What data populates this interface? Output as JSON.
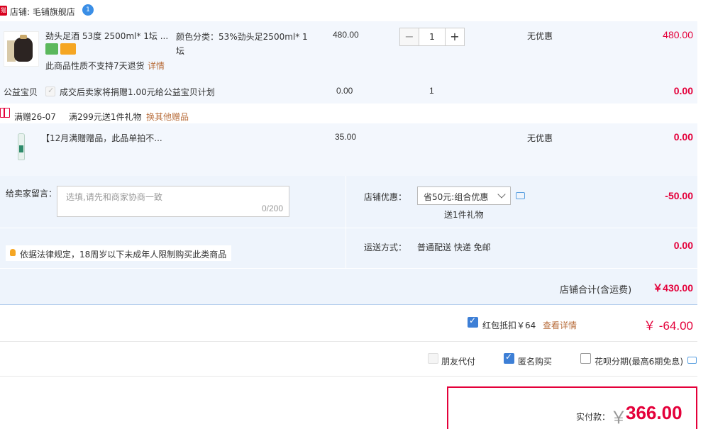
{
  "shop": {
    "badge": "猫",
    "name": "店铺: 毛铺旗舰店",
    "ww": "1"
  },
  "item": {
    "title": "劲头足酒 53度 2500ml* 1坛 ...",
    "sku_label": "颜色分类：53%劲头足2500ml* 1坛",
    "price": "480.00",
    "quantity": "1",
    "discount": "无优惠",
    "subtotal": "480.00",
    "no_return": "此商品性质不支持7天退货",
    "detail_link": "详情"
  },
  "charity": {
    "label": "公益宝贝",
    "text": "成交后卖家将捐赠1.00元给公益宝贝计划",
    "price": "0.00",
    "quantity": "1",
    "subtotal": "0.00"
  },
  "gift_promo": {
    "tag": "满赠26-07",
    "text": "满299元送1件礼物",
    "change_link": "换其他赠品"
  },
  "gift_item": {
    "title": "【12月满赠赠品，此品单拍不...",
    "price": "35.00",
    "discount": "无优惠",
    "subtotal": "0.00"
  },
  "summary": {
    "memo_label": "给卖家留言：",
    "memo_placeholder": "选填,请先和商家协商一致",
    "memo_count": "0/200",
    "shop_discount_label": "店铺优惠：",
    "shop_discount_value": "省50元:组合优惠",
    "shop_discount_gift": "送1件礼物",
    "shop_discount_amount": "-50.00",
    "delivery_label": "运送方式：",
    "delivery_value": "普通配送 快递 免邮",
    "delivery_amount": "0.00",
    "legal_tip": "依据法律规定，18周岁以下未成年人限制购买此类商品",
    "total_label": "店铺合计(含运费)",
    "total_value": "￥430.00"
  },
  "redpacket": {
    "label": "红包抵扣￥64",
    "link": "查看详情",
    "amount": "￥ -64.00"
  },
  "options": {
    "friend_pay": "朋友代付",
    "anonymous": "匿名购买",
    "huabei": "花呗分期(最高6期免息)"
  },
  "pay": {
    "label": "实付款：",
    "currency": "￥",
    "amount": "366.00"
  },
  "colors": {
    "accent_red": "#e4003a",
    "panel_blue": "#eef4fc",
    "row_blue": "#f3f7fd",
    "check_blue": "#3d7fd6",
    "link_orange": "#b86e3c"
  }
}
